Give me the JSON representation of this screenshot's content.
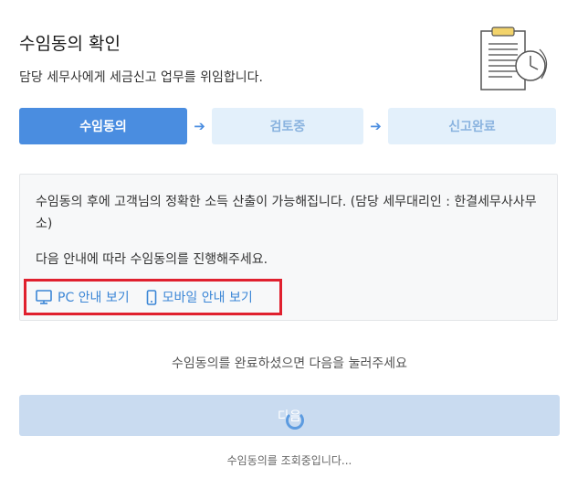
{
  "header": {
    "title": "수임동의 확인",
    "subtitle": "담당 세무사에게 세금신고 업무를 위임합니다."
  },
  "steps": [
    {
      "label": "수임동의",
      "state": "active"
    },
    {
      "label": "검토중",
      "state": "inactive"
    },
    {
      "label": "신고완료",
      "state": "inactive"
    }
  ],
  "info": {
    "line1": "수임동의 후에 고객님의 정확한 소득 산출이 가능해집니다. (담당 세무대리인 : 한결세무사사무소)",
    "line2": "다음 안내에 따라 수임동의를 진행해주세요.",
    "pc_guide_label": "PC 안내 보기",
    "mobile_guide_label": "모바일 안내 보기"
  },
  "footer": {
    "hint": "수임동의를 완료하셨으면 다음을 눌러주세요",
    "next_label": "다음",
    "status": "수임동의를 조회중입니다..."
  },
  "colors": {
    "accent": "#4a8de0",
    "step_inactive_bg": "#e3f0fb",
    "highlight_border": "#e0202e",
    "link": "#3b86d6",
    "button_disabled": "#c9dbf0"
  }
}
